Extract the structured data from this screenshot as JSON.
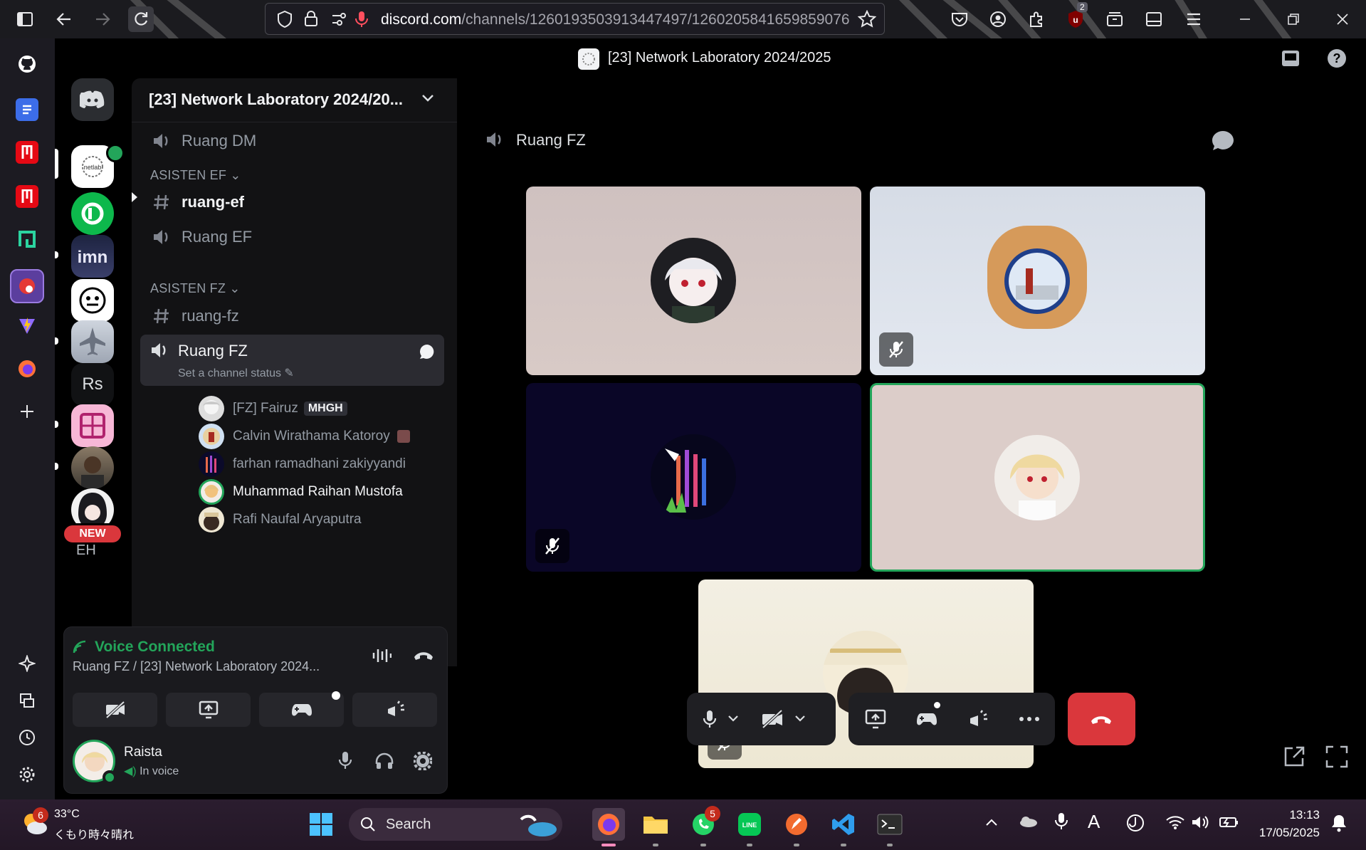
{
  "browser": {
    "url_host": "discord.com",
    "url_path": "/channels/1260193503913447497/1260205841659859076",
    "notification_count": "2"
  },
  "discord": {
    "window_title": "[23] Network Laboratory 2024/2025",
    "server_name": "[23] Network Laboratory 2024/20...",
    "rail": {
      "rs_label": "Rs",
      "eh_label": "EH",
      "new_badge": "NEW"
    },
    "channels": {
      "ruang_dm": "Ruang DM",
      "cat_ef": "ASISTEN EF",
      "ruang_ef_text": "ruang-ef",
      "ruang_ef_voice": "Ruang EF",
      "cat_fz": "ASISTEN FZ",
      "ruang_fz_text": "ruang-fz",
      "ruang_fz_voice": "Ruang FZ",
      "channel_status": "Set a channel status"
    },
    "members": [
      {
        "name": "[FZ] Fairuz",
        "tag": "MHGH"
      },
      {
        "name": "Calvin Wirathama Katoroy"
      },
      {
        "name": "farhan ramadhani zakiyyandi"
      },
      {
        "name": "Muhammad Raihan Mustofa"
      },
      {
        "name": "Rafi Naufal Aryaputra"
      }
    ],
    "voice": {
      "status": "Voice Connected",
      "location": "Ruang FZ / [23] Network Laboratory 2024..."
    },
    "user": {
      "name": "Raista",
      "status": "In voice"
    },
    "stage_channel": "Ruang FZ"
  },
  "taskbar": {
    "weather_temp": "33°C",
    "weather_desc": "くもり時々晴れ",
    "weather_badge": "6",
    "search_placeholder": "Search",
    "whatsapp_badge": "5",
    "time": "13:13",
    "date": "17/05/2025"
  },
  "colors": {
    "green": "#23a55a",
    "danger": "#da373c",
    "panel": "#121214"
  }
}
